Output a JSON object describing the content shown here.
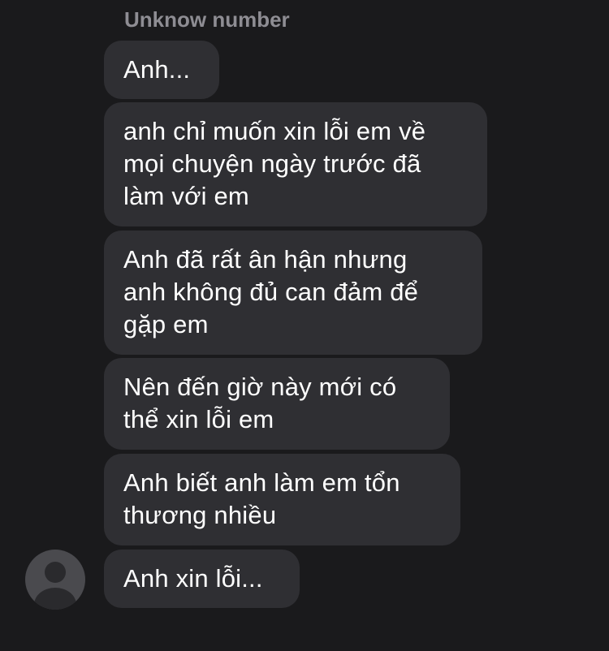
{
  "conversation": {
    "sender_name": "Unknow number",
    "messages": [
      {
        "text": "Anh..."
      },
      {
        "text": "anh chỉ muốn xin lỗi em về\nmọi chuyện ngày trước đã\nlàm với em"
      },
      {
        "text": "Anh đã rất ân hận nhưng\nanh không đủ can đảm để\ngặp em"
      },
      {
        "text": "Nên đến giờ này mới có\nthể xin lỗi em"
      },
      {
        "text": "Anh biết anh làm em tổn\nthương nhiều"
      },
      {
        "text": "Anh xin lỗi..."
      }
    ],
    "avatar_icon": "default-user-avatar-icon"
  },
  "colors": {
    "background": "#1a1a1c",
    "bubble": "#2f2f33",
    "text": "#ffffff",
    "sender_name": "#8e8d93"
  }
}
